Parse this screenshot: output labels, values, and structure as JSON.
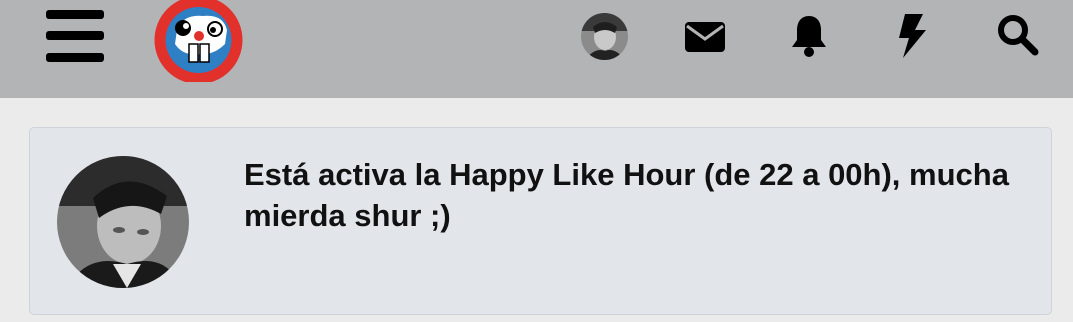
{
  "topbar": {
    "menu_icon": "hamburger-menu-icon",
    "logo_icon": "site-logo",
    "avatar_icon": "user-avatar",
    "icons": [
      "envelope-icon",
      "bell-icon",
      "bolt-icon",
      "search-icon"
    ]
  },
  "notice": {
    "avatar_icon": "user-avatar",
    "message": "Está activa la Happy Like Hour (de 22 a 00h), mucha mierda shur ;)"
  },
  "colors": {
    "topbar_bg": "#b3b4b6",
    "page_bg": "#ebebeb",
    "card_bg": "#e2e5e9",
    "logo_red": "#e2302a",
    "logo_blue": "#2f7fc4"
  }
}
